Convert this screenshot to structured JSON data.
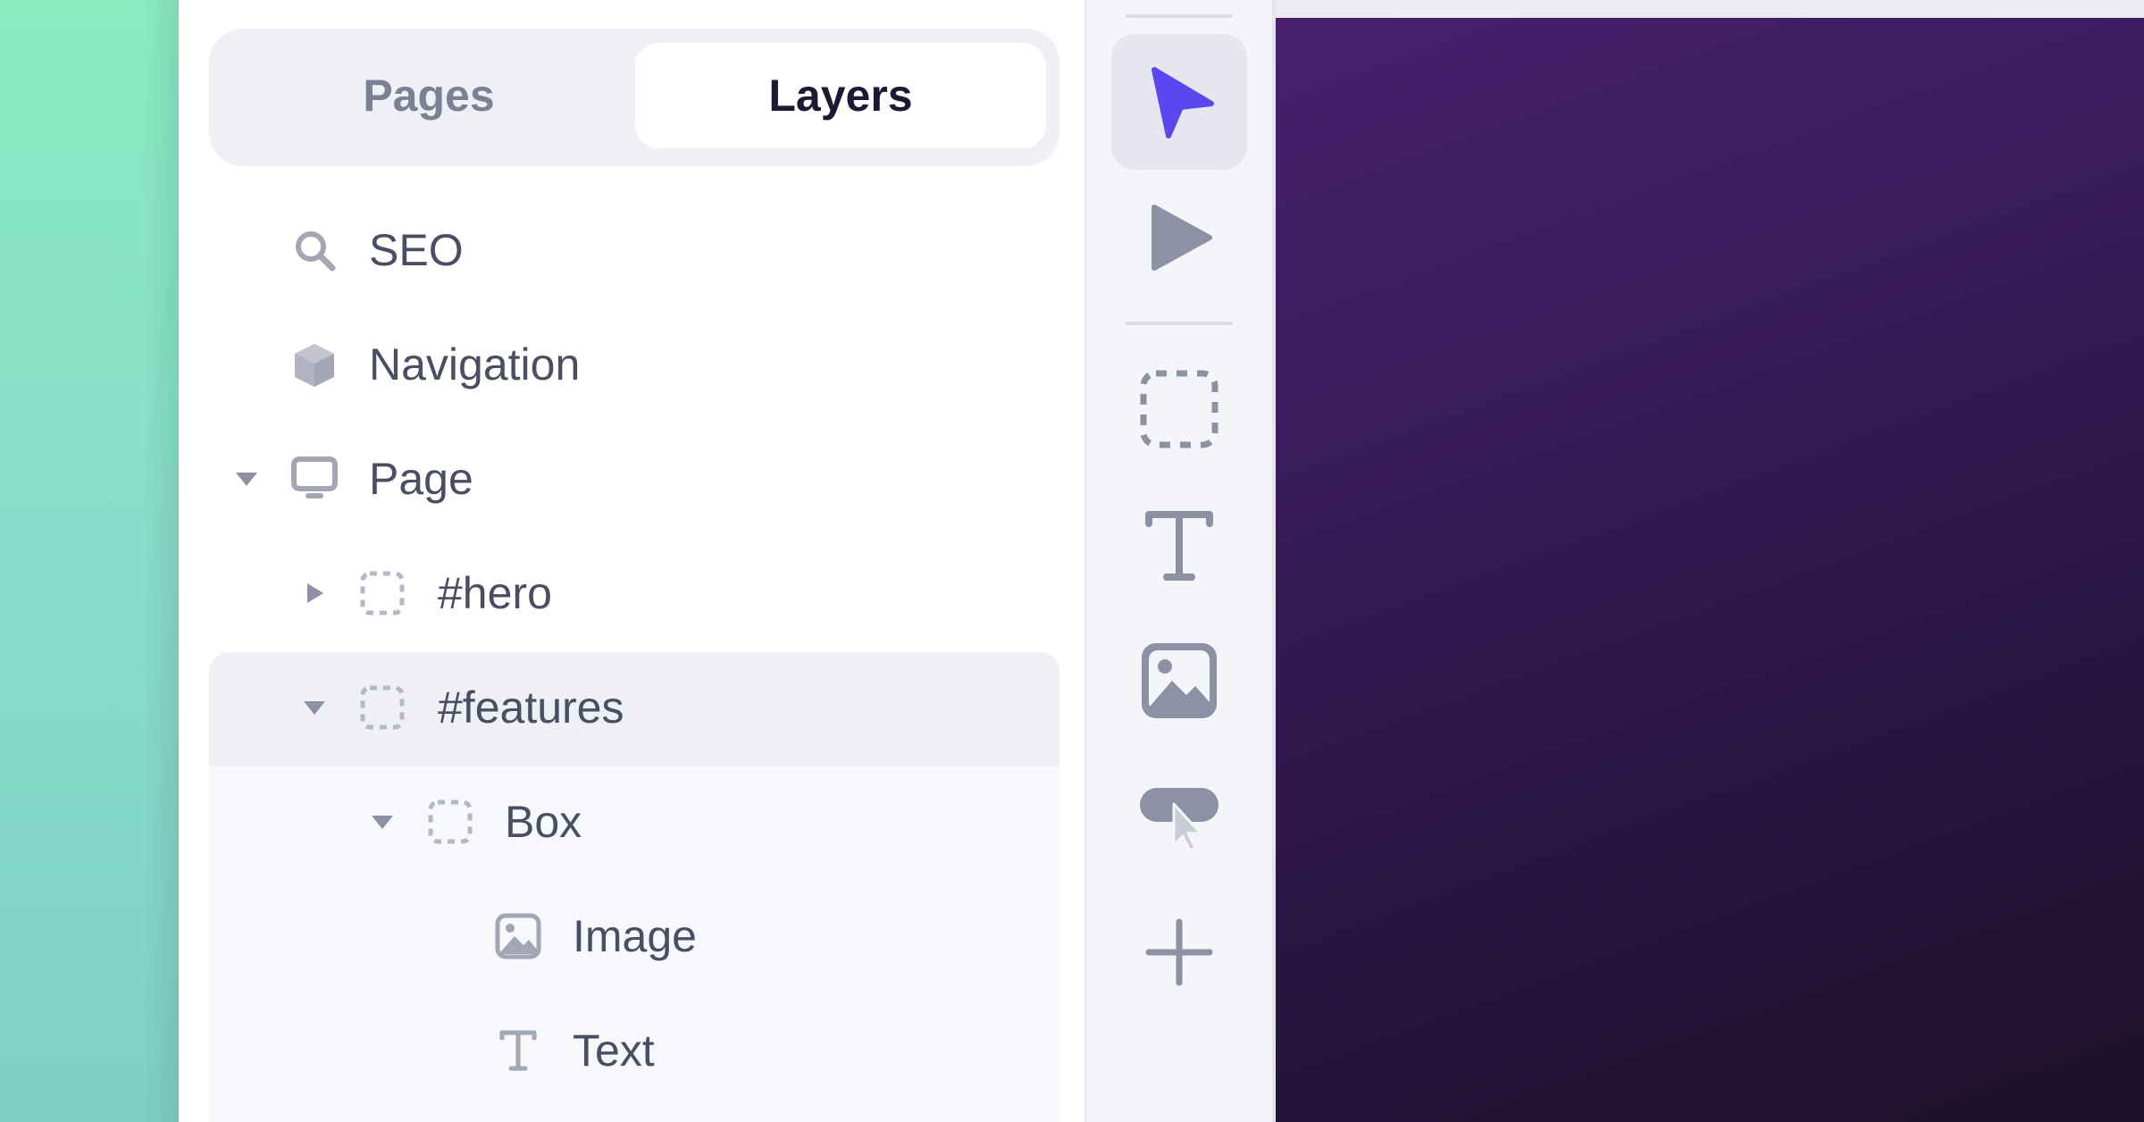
{
  "tabs": {
    "pages": "Pages",
    "layers": "Layers",
    "active": "Layers"
  },
  "layers": [
    {
      "label": "SEO",
      "icon": "search-icon"
    },
    {
      "label": "Navigation",
      "icon": "component-icon"
    },
    {
      "label": "Page",
      "icon": "monitor-icon",
      "expanded": true
    },
    {
      "label": "#hero",
      "icon": "box-outline-icon",
      "expanded": false
    },
    {
      "label": "#features",
      "icon": "box-outline-icon",
      "expanded": true,
      "selected": true
    },
    {
      "label": "Box",
      "icon": "box-outline-icon",
      "expanded": true
    },
    {
      "label": "Image",
      "icon": "image-icon"
    },
    {
      "label": "Text",
      "icon": "text-icon"
    }
  ],
  "toolbar": {
    "tools": [
      {
        "name": "select-tool",
        "icon": "pointer-icon",
        "active": true
      },
      {
        "name": "preview-tool",
        "icon": "play-icon"
      },
      {
        "name": "box-tool",
        "icon": "box-outline-icon"
      },
      {
        "name": "text-tool",
        "icon": "text-icon"
      },
      {
        "name": "image-tool",
        "icon": "image-icon"
      },
      {
        "name": "button-tool",
        "icon": "button-icon"
      },
      {
        "name": "add-tool",
        "icon": "plus-icon"
      }
    ]
  },
  "colors": {
    "accent": "#5b46f0",
    "tab_active_text": "#1c1a33",
    "tab_inactive_text": "#7d7f93",
    "row_text": "#4b4d63",
    "icon_gray": "#9a9cae",
    "selected_row_bg": "#eff0f6",
    "canvas_top": "#46206d",
    "canvas_bottom": "#1b1128"
  }
}
